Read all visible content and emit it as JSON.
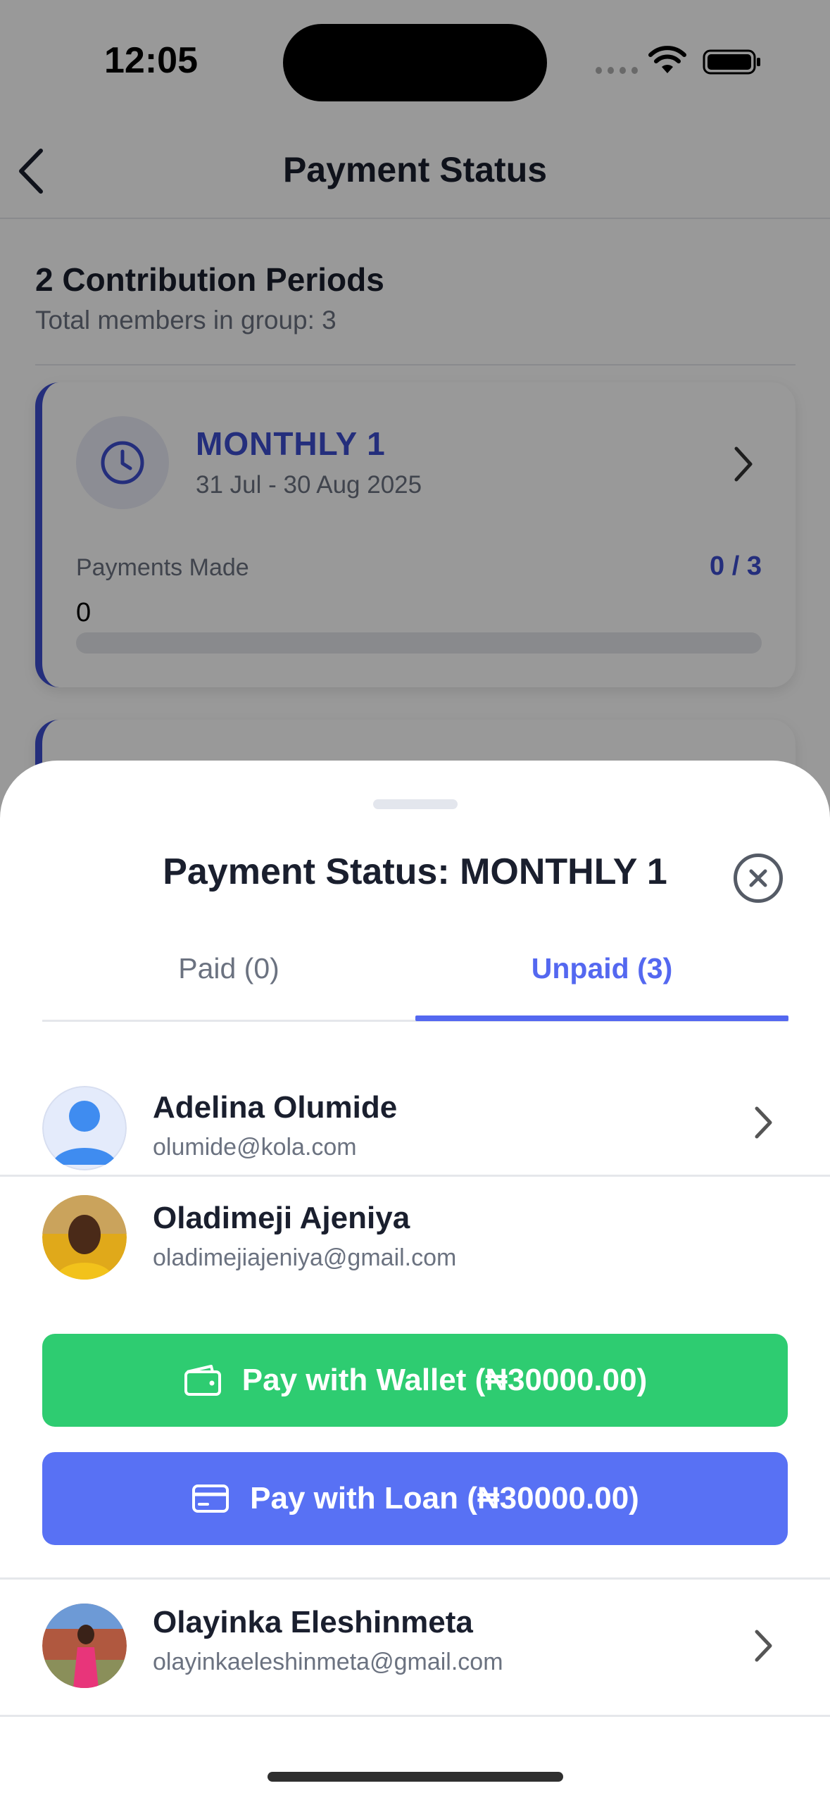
{
  "status_bar": {
    "time": "12:05"
  },
  "nav": {
    "title": "Payment Status"
  },
  "summary": {
    "title": "2 Contribution Periods",
    "subtitle": "Total members in group: 3"
  },
  "period_card": {
    "name": "MONTHLY 1",
    "dates": "31 Jul - 30 Aug 2025",
    "payments_label": "Payments Made",
    "payments_count": "0 / 3",
    "payments_made": "0",
    "progress_fraction": 0
  },
  "sheet": {
    "title": "Payment Status: MONTHLY 1",
    "tabs": [
      {
        "label": "Paid (0)",
        "active": false
      },
      {
        "label": "Unpaid (3)",
        "active": true
      }
    ],
    "members": [
      {
        "name": "Adelina Olumide",
        "email": "olumide@kola.com",
        "expanded": false
      },
      {
        "name": "Oladimeji Ajeniya",
        "email": "oladimejiajeniya@gmail.com",
        "expanded": true
      },
      {
        "name": "Olayinka Eleshinmeta",
        "email": "olayinkaeleshinmeta@gmail.com",
        "expanded": false
      }
    ],
    "buttons": {
      "wallet_label": "Pay with Wallet (₦30000.00)",
      "loan_label": "Pay with Loan (₦30000.00)"
    }
  },
  "colors": {
    "accent": "#5468f0",
    "period_accent": "#3d4ecf",
    "wallet_green": "#2ecc71",
    "loan_blue": "#5871f4"
  },
  "icons": [
    "back-chevron-icon",
    "clock-icon",
    "chevron-right-icon",
    "close-icon",
    "wallet-icon",
    "credit-card-icon",
    "wifi-icon",
    "battery-icon"
  ]
}
